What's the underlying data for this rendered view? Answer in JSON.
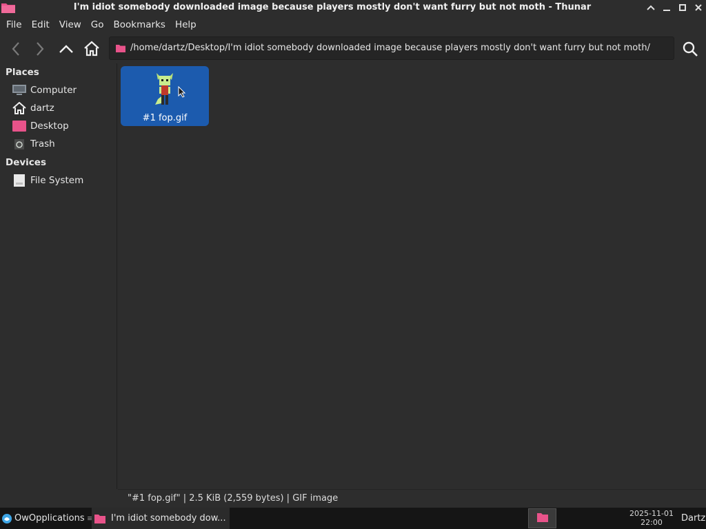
{
  "window": {
    "title": "I'm idiot somebody downloaded image because players mostly don't want furry but not moth - Thunar",
    "app_icon": "folder-icon",
    "controls": [
      "roll-up-icon",
      "minimize-icon",
      "maximize-icon",
      "close-icon"
    ]
  },
  "menubar": {
    "items": [
      "File",
      "Edit",
      "View",
      "Go",
      "Bookmarks",
      "Help"
    ]
  },
  "toolbar": {
    "buttons": [
      "back-icon",
      "forward-icon",
      "parent-folder-icon",
      "home-icon"
    ],
    "location_path": "/home/dartz/Desktop/I'm idiot somebody downloaded image because players mostly don't want furry but not moth/",
    "search_icon": "search-icon"
  },
  "sidebar": {
    "places_title": "Places",
    "places": [
      {
        "label": "Computer",
        "icon": "computer-icon"
      },
      {
        "label": "dartz",
        "icon": "home-icon"
      },
      {
        "label": "Desktop",
        "icon": "desktop-folder-icon"
      },
      {
        "label": "Trash",
        "icon": "trash-icon"
      }
    ],
    "devices_title": "Devices",
    "devices": [
      {
        "label": "File System",
        "icon": "drive-icon"
      }
    ]
  },
  "files": [
    {
      "name": "#1 fop.gif",
      "selected": true,
      "thumbnail": "pixel-character-thumbnail"
    }
  ],
  "statusbar": {
    "text": "\"#1 fop.gif\"  |  2.5 KiB (2,559 bytes)  |  GIF image"
  },
  "taskbar": {
    "start_label": "OwOpplications",
    "separator": "≡",
    "task_label": "I'm idiot somebody dow...",
    "clock_date": "2025-11-01",
    "clock_time": "22:00",
    "user": "Dartz"
  },
  "colors": {
    "accent_selection": "#1c5bae",
    "folder_pink": "#e8538a",
    "background": "#2d2d2d"
  }
}
